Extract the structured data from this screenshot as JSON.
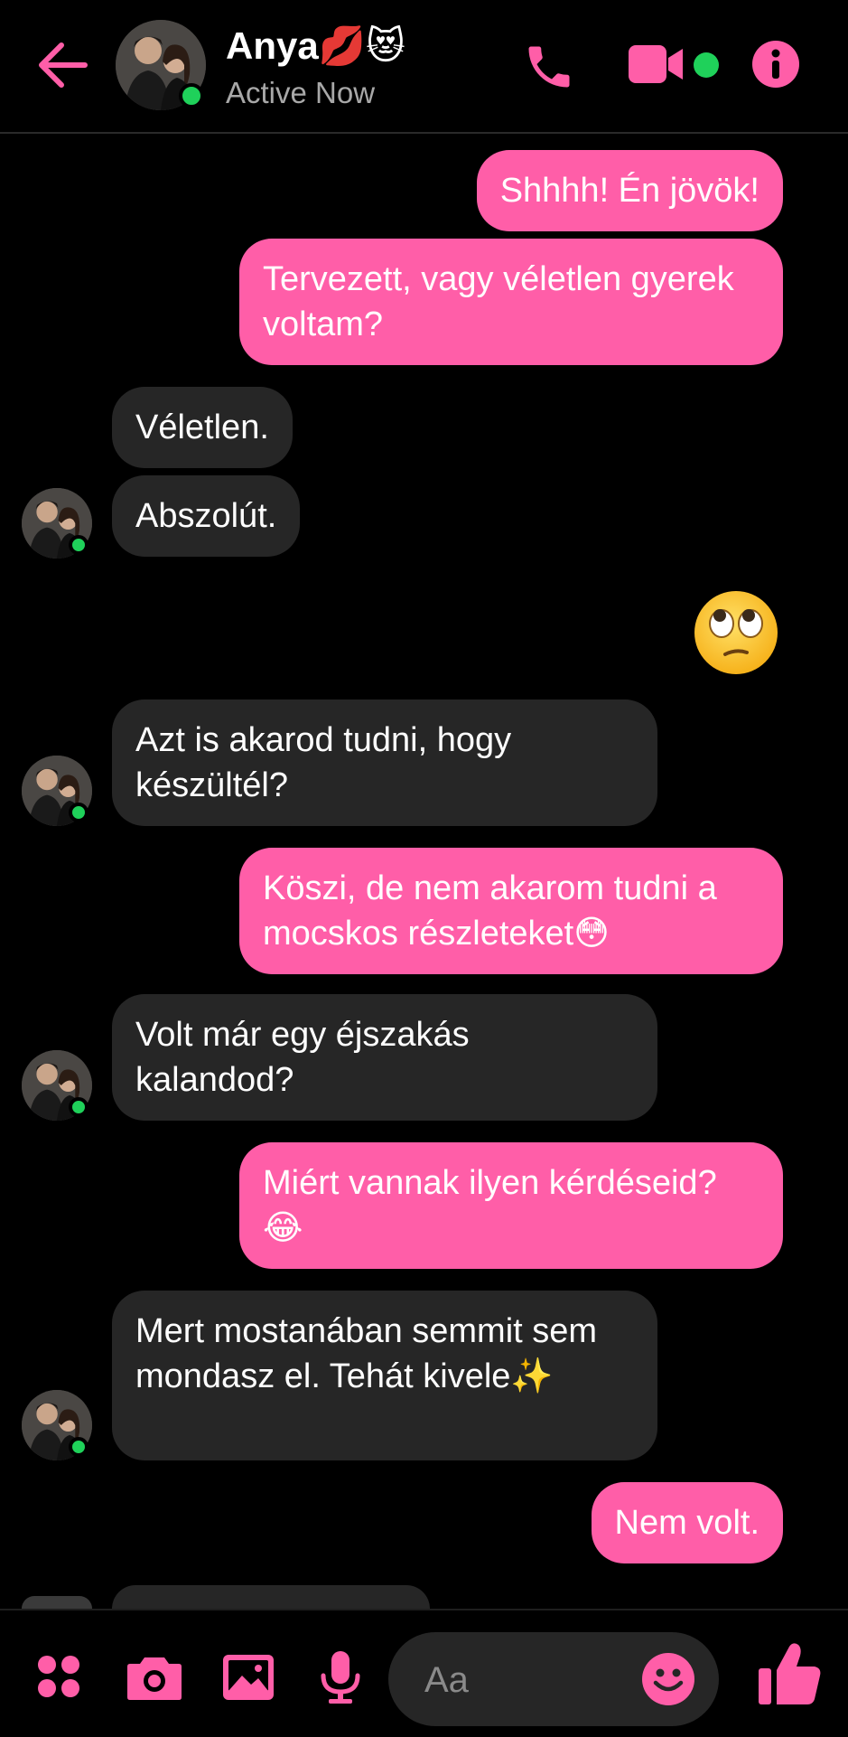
{
  "header": {
    "name": "Anya💋😻",
    "status": "Active Now",
    "back_icon": "back-arrow-icon",
    "call_icon": "phone-icon",
    "video_icon": "video-camera-icon",
    "info_icon": "info-icon"
  },
  "colors": {
    "accent": "#ff5ea8",
    "incoming_bubble": "#262626",
    "online": "#1fd15a",
    "background": "#000000"
  },
  "messages": [
    {
      "from": "me",
      "text": "Shhhh! Én jövök!"
    },
    {
      "from": "me",
      "text": "Tervezett, vagy véletlen gyerek voltam?"
    },
    {
      "from": "them",
      "text": "Véletlen."
    },
    {
      "from": "them",
      "text": "Abszolút."
    },
    {
      "from": "me",
      "emoji": "face-with-rolling-eyes"
    },
    {
      "from": "them",
      "text": "Azt is akarod tudni, hogy készültél?"
    },
    {
      "from": "me",
      "text": "Köszi, de nem akarom tudni a mocskos részleteket😳"
    },
    {
      "from": "them",
      "text": "Volt már egy éjszakás kalandod?"
    },
    {
      "from": "me",
      "text": "Miért vannak ilyen kérdéseid? 😂"
    },
    {
      "from": "them",
      "text": "Mert mostanában semmit sem mondasz el. Tehát kivele✨"
    },
    {
      "from": "me",
      "text": "Nem volt."
    }
  ],
  "composer": {
    "placeholder": "Aa",
    "icons": [
      "menu-dots-icon",
      "camera-icon",
      "image-icon",
      "microphone-icon",
      "smiley-icon",
      "thumbs-up-icon"
    ]
  }
}
